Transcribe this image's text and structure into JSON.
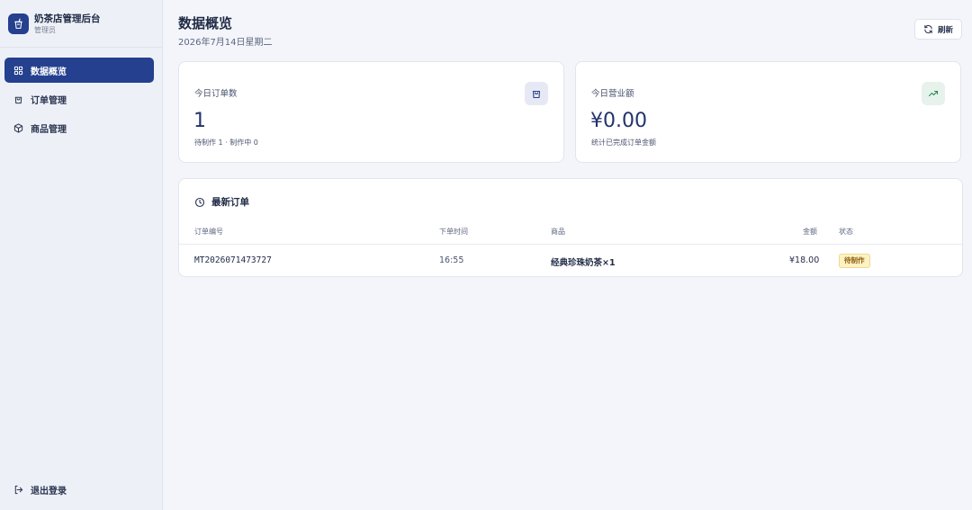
{
  "app": {
    "title": "奶茶店管理后台",
    "role": "管理员"
  },
  "sidebar": {
    "items": [
      {
        "label": "数据概览",
        "icon": "grid-icon",
        "active": true
      },
      {
        "label": "订单管理",
        "icon": "bag-icon",
        "active": false
      },
      {
        "label": "商品管理",
        "icon": "box-icon",
        "active": false
      }
    ],
    "logout_label": "退出登录"
  },
  "header": {
    "title": "数据概览",
    "date": "2026年7月14日星期二",
    "refresh_label": "刷新"
  },
  "stats": [
    {
      "label": "今日订单数",
      "value": "1",
      "note": "待制作 1 · 制作中 0",
      "icon": "shopping-bag-icon",
      "icon_bg": "#e6e9f4"
    },
    {
      "label": "今日营业额",
      "value": "¥0.00",
      "note": "统计已完成订单金额",
      "icon": "trending-up-icon",
      "icon_bg": "#e8f2ec"
    }
  ],
  "orders": {
    "title": "最新订单",
    "columns": [
      "订单编号",
      "下单时间",
      "商品",
      "金额",
      "状态"
    ],
    "rows": [
      {
        "id": "MT2026071473727",
        "time": "16:55",
        "items": "经典珍珠奶茶×1",
        "amount": "¥18.00",
        "status": "待制作"
      }
    ]
  },
  "colors": {
    "accent": "#24408e",
    "status_pending_bg": "#fdf2c4",
    "status_pending_text": "#8a5a0a"
  }
}
